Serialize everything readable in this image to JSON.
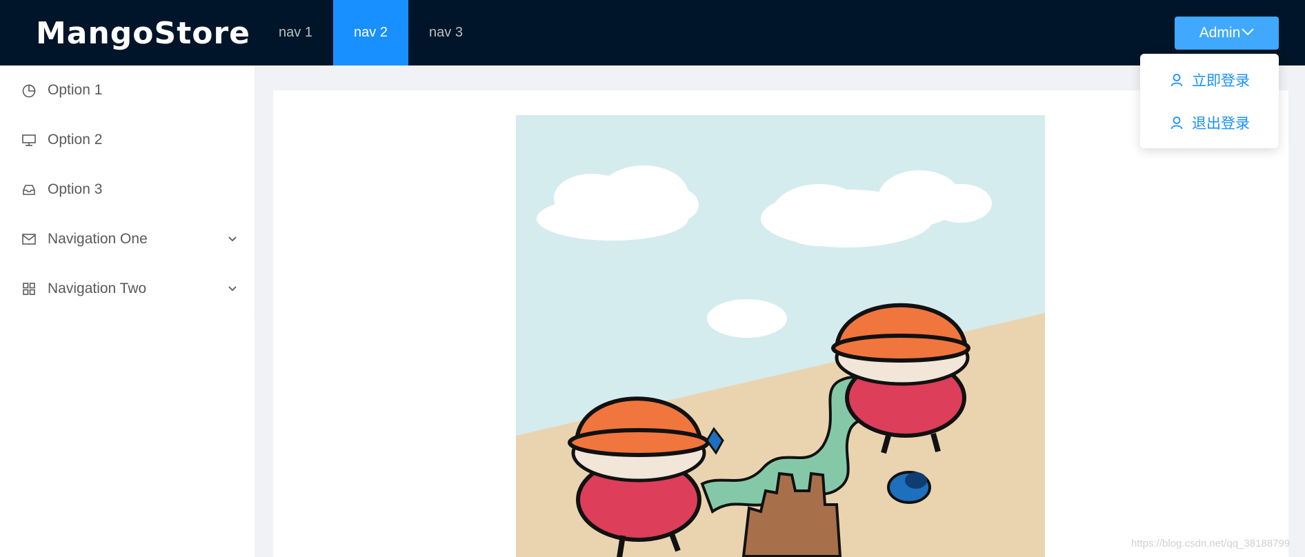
{
  "header": {
    "logo": "MangoStore",
    "nav": [
      {
        "label": "nav 1",
        "active": false
      },
      {
        "label": "nav 2",
        "active": true
      },
      {
        "label": "nav 3",
        "active": false
      }
    ],
    "user_button": "Admin",
    "user_button_icon": "chevron-down-icon"
  },
  "dropdown": {
    "items": [
      {
        "label": "立即登录",
        "icon": "user-icon"
      },
      {
        "label": "退出登录",
        "icon": "user-icon"
      }
    ]
  },
  "sidebar": {
    "items": [
      {
        "label": "Option 1",
        "icon": "pie-chart-icon"
      },
      {
        "label": "Option 2",
        "icon": "desktop-icon"
      },
      {
        "label": "Option 3",
        "icon": "inbox-icon"
      },
      {
        "label": "Navigation One",
        "icon": "mail-icon",
        "expandable": true
      },
      {
        "label": "Navigation Two",
        "icon": "appstore-icon",
        "expandable": true
      }
    ]
  },
  "content": {
    "image": "beach-sandcastle-illustration"
  },
  "watermark": "https://blog.csdn.net/qq_38188799",
  "colors": {
    "header_bg": "#001529",
    "primary": "#1890ff",
    "admin_button": "#40a9ff",
    "page_bg": "#f0f2f5"
  }
}
